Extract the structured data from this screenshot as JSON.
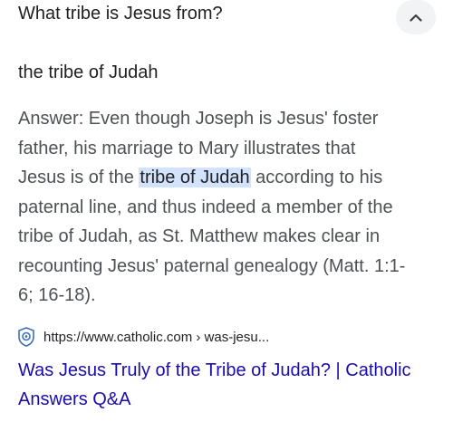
{
  "question": {
    "text": "What tribe is Jesus from?",
    "toggle_icon": "chevron-up-icon"
  },
  "answer": {
    "short": "the tribe of Judah",
    "snippet_lines": {
      "l1": "Answer: Even though Joseph is Jesus' foster",
      "l2": "father, his marriage to Mary illustrates that",
      "l3_pre": "Jesus is of the ",
      "l3_hl": "tribe of Judah",
      "l3_post": " according to his",
      "l4": "paternal line, and thus indeed a member of the",
      "l5": "tribe of Judah, as St. Matthew makes clear in",
      "l6": "recounting Jesus' paternal genealogy (Matt. 1:1-",
      "l7": "6; 16-18)."
    }
  },
  "source": {
    "favicon": "catholic-answers-favicon",
    "url": "https://www.catholic.com › was-jesu...",
    "title_line1": "Was Jesus Truly of the Tribe of Judah? | Catholic",
    "title_line2": "Answers Q&A"
  },
  "colors": {
    "highlight": "#d3e3fd",
    "link": "#1a0dab",
    "text": "#202124",
    "snippet": "#4d5156",
    "toggle_bg": "#f1f3f4"
  }
}
